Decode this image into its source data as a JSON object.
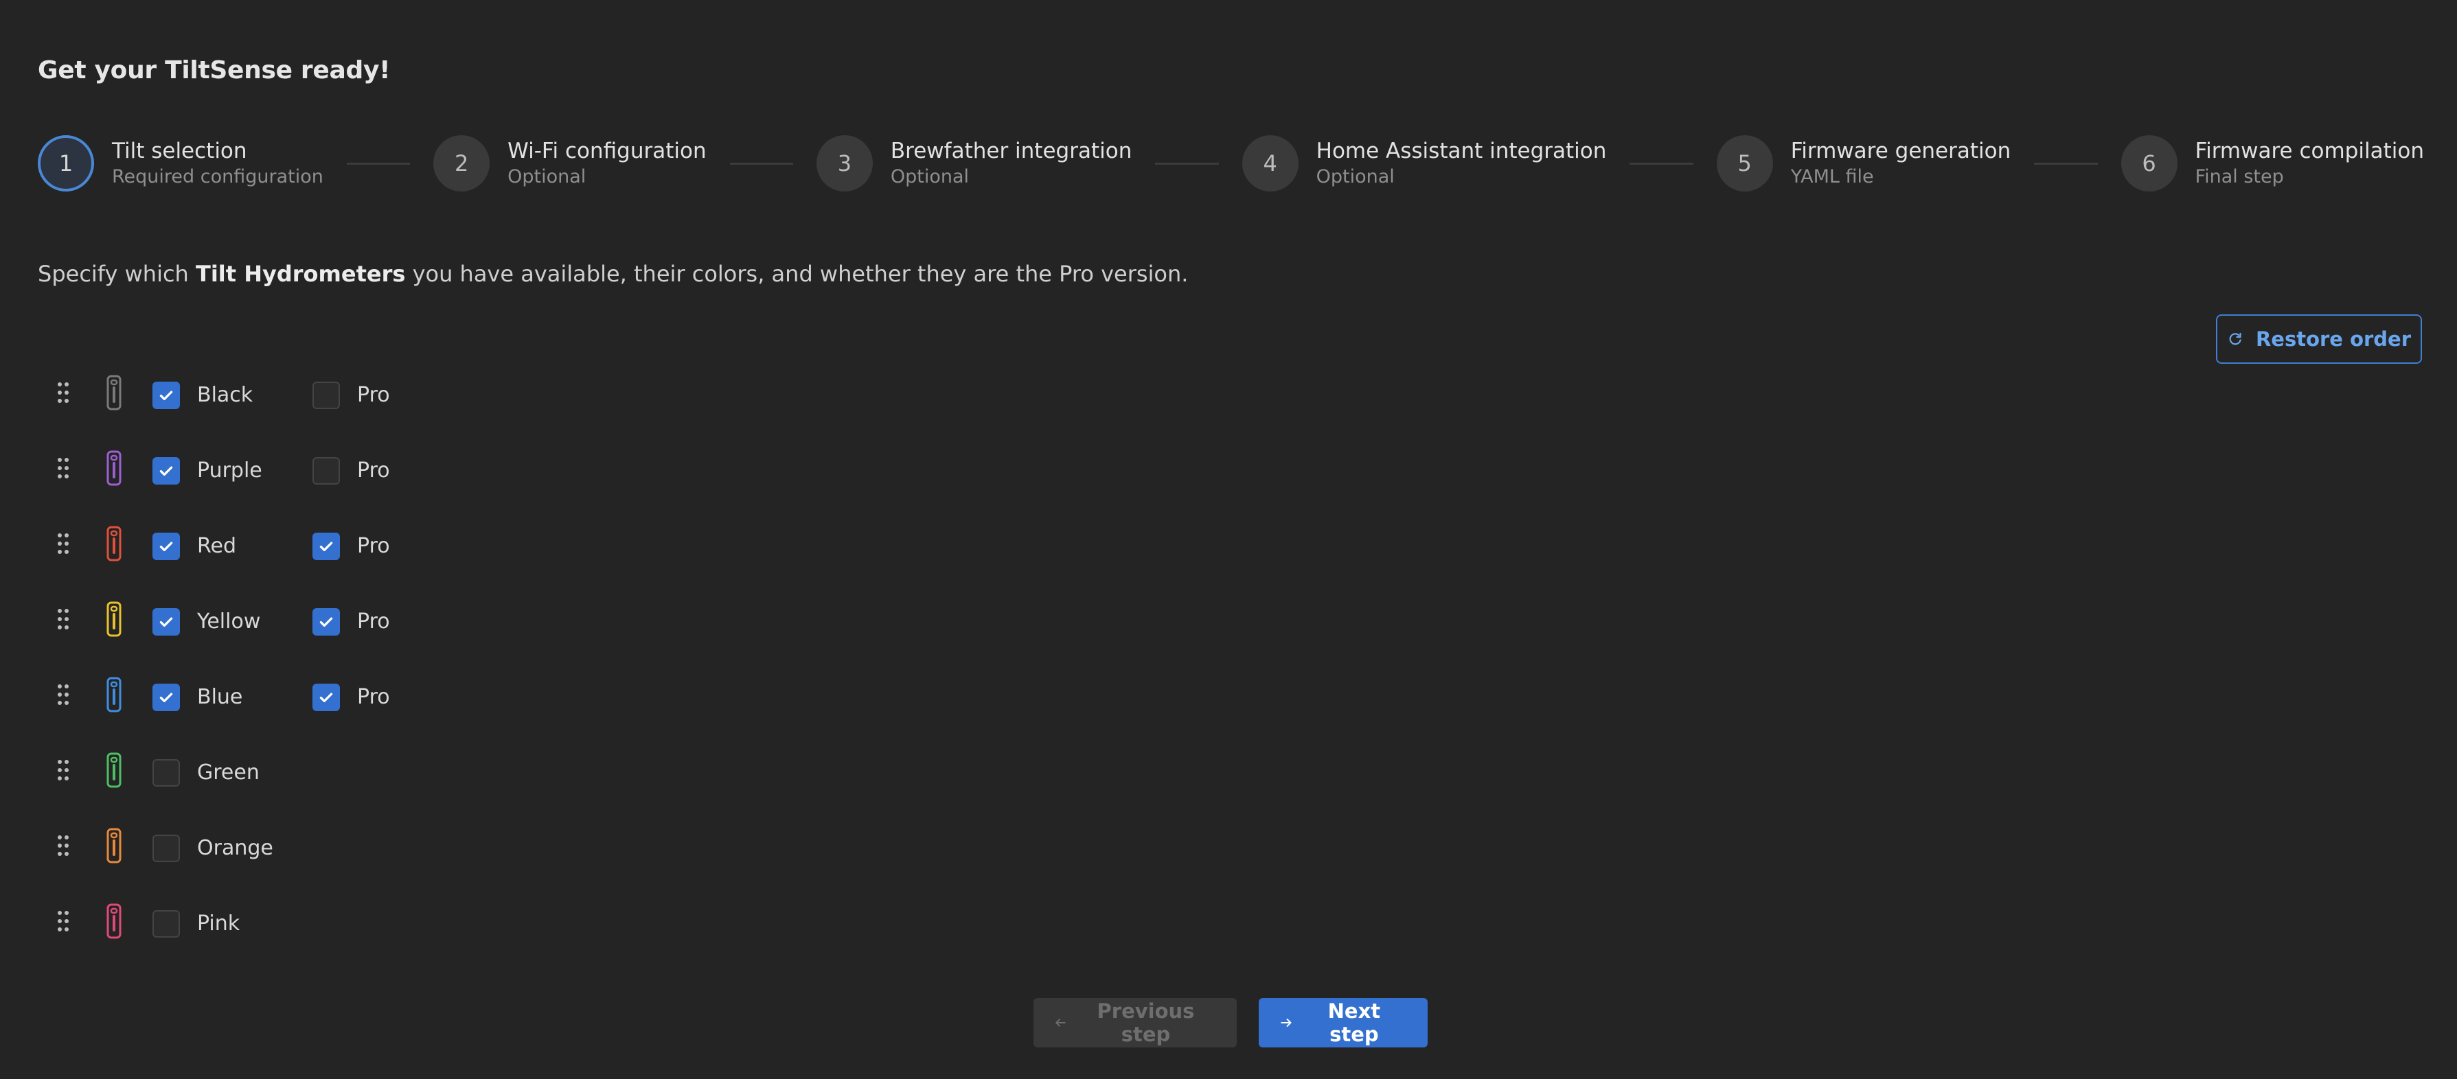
{
  "header": {
    "title": "Get your TiltSense ready!"
  },
  "stepper": {
    "steps": [
      {
        "number": "1",
        "label": "Tilt selection",
        "desc": "Required configuration",
        "active": true
      },
      {
        "number": "2",
        "label": "Wi-Fi configuration",
        "desc": "Optional",
        "active": false
      },
      {
        "number": "3",
        "label": "Brewfather integration",
        "desc": "Optional",
        "active": false
      },
      {
        "number": "4",
        "label": "Home Assistant integration",
        "desc": "Optional",
        "active": false
      },
      {
        "number": "5",
        "label": "Firmware generation",
        "desc": "YAML file",
        "active": false
      },
      {
        "number": "6",
        "label": "Firmware compilation",
        "desc": "Final step",
        "active": false
      }
    ]
  },
  "intro": {
    "prefix": "Specify which ",
    "bold": "Tilt Hydrometers",
    "suffix": " you have available, their colors, and whether they are the Pro version."
  },
  "restore": {
    "label": "Restore order",
    "icon": "refresh-icon"
  },
  "tilts": [
    {
      "name": "Black",
      "color": "#7a7a7a",
      "checked": true,
      "pro": false,
      "pro_label": "Pro"
    },
    {
      "name": "Purple",
      "color": "#9b5fd1",
      "checked": true,
      "pro": false,
      "pro_label": "Pro"
    },
    {
      "name": "Red",
      "color": "#e0503a",
      "checked": true,
      "pro": true,
      "pro_label": "Pro"
    },
    {
      "name": "Yellow",
      "color": "#e8c22e",
      "checked": true,
      "pro": true,
      "pro_label": "Pro"
    },
    {
      "name": "Blue",
      "color": "#3f8ee0",
      "checked": true,
      "pro": true,
      "pro_label": "Pro"
    },
    {
      "name": "Green",
      "color": "#4cbf63",
      "checked": false,
      "pro": null,
      "pro_label": ""
    },
    {
      "name": "Orange",
      "color": "#e8893a",
      "checked": false,
      "pro": null,
      "pro_label": ""
    },
    {
      "name": "Pink",
      "color": "#e04a78",
      "checked": false,
      "pro": null,
      "pro_label": ""
    }
  ],
  "footer": {
    "prev_label": "Previous step",
    "next_label": "Next step",
    "prev_icon": "arrow-left-icon",
    "next_icon": "arrow-right-icon"
  },
  "colors": {
    "accent": "#3470cf",
    "background": "#242424"
  }
}
